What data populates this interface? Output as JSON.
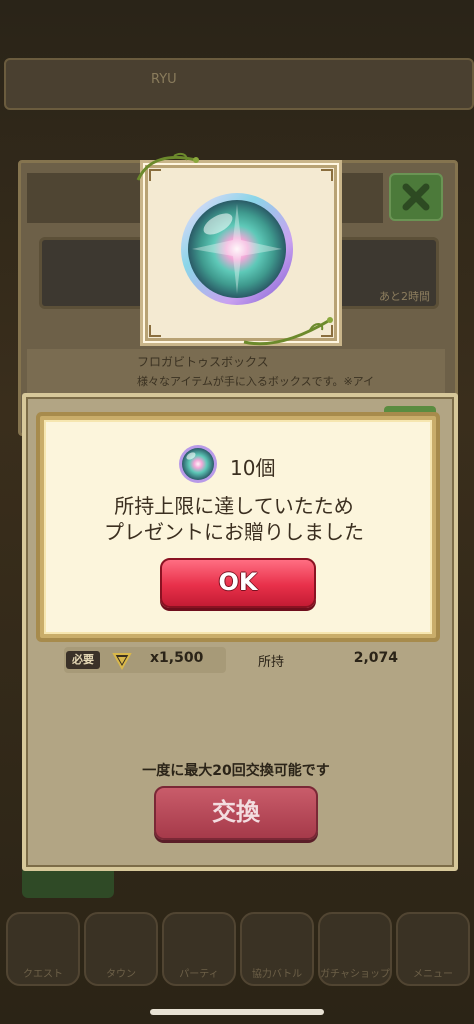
{
  "background": {
    "topbar": {
      "player_name": "RYU"
    },
    "box_panel": {
      "title": "フロガビトゥスボックス",
      "description": "様々なアイテムが手に入るボックスです。※アイ",
      "banner_right_label": "あと2時間"
    },
    "bottom_nav": [
      {
        "label": "クエスト"
      },
      {
        "label": "タウン"
      },
      {
        "label": "パーティ"
      },
      {
        "label": "協力バトル"
      },
      {
        "label": "ガチャショップ"
      },
      {
        "label": "メニュー"
      }
    ]
  },
  "exchange_dialog": {
    "required_label": "必要",
    "cost_text": "x1,500",
    "owned_label": "所持",
    "owned_value": "2,074",
    "max_note": "一度に最大20回交換可能です",
    "exchange_button_label": "交換"
  },
  "notice_popup": {
    "item_count": "10個",
    "message_line1": "所持上限に達していたため",
    "message_line2": "プレゼントにお贈りしました",
    "ok_label": "OK"
  },
  "colors": {
    "ok_button": "#e8304a",
    "exchange_button": "#a63a4a",
    "popup_bg": "#fcf5dc",
    "dialog_bg": "#b2a584"
  },
  "icons": {
    "item": "rainbow-orb-icon",
    "medal": "medal-icon",
    "close": "close-icon"
  }
}
